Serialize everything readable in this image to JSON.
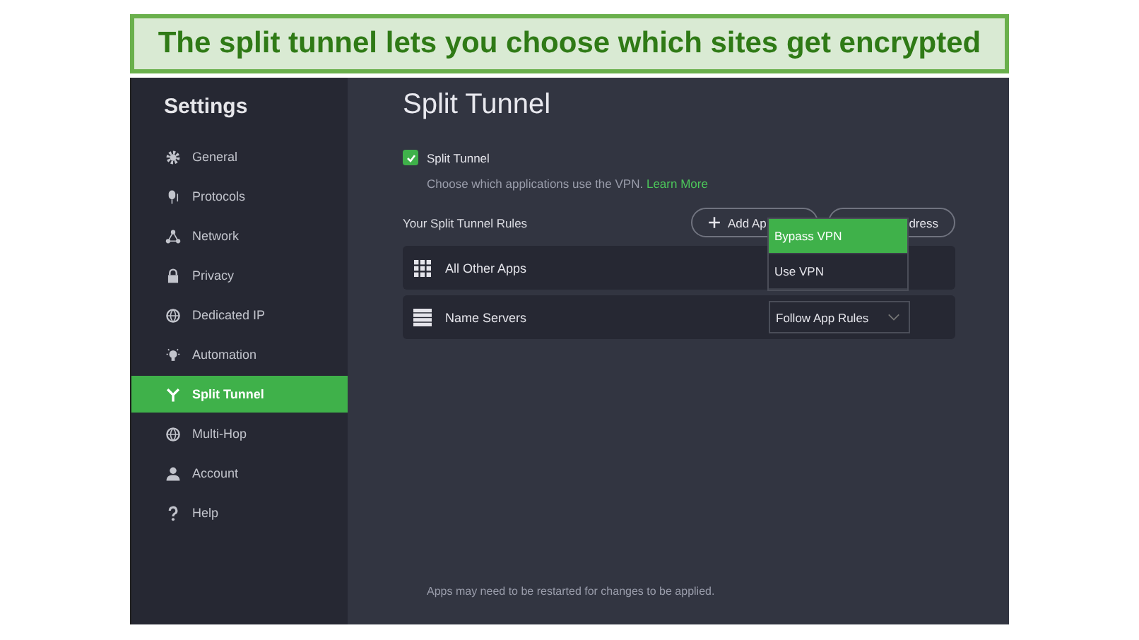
{
  "banner": {
    "text": "The split tunnel lets you choose which sites get encrypted"
  },
  "sidebar": {
    "title": "Settings",
    "items": [
      {
        "label": "General",
        "kind": "gear",
        "selected": false
      },
      {
        "label": "Protocols",
        "kind": "protocol",
        "selected": false
      },
      {
        "label": "Network",
        "kind": "network",
        "selected": false
      },
      {
        "label": "Privacy",
        "kind": "lock",
        "selected": false
      },
      {
        "label": "Dedicated IP",
        "kind": "globe",
        "selected": false
      },
      {
        "label": "Automation",
        "kind": "bulb",
        "selected": false
      },
      {
        "label": "Split Tunnel",
        "kind": "fork",
        "selected": true
      },
      {
        "label": "Multi-Hop",
        "kind": "globe",
        "selected": false
      },
      {
        "label": "Account",
        "kind": "person",
        "selected": false
      },
      {
        "label": "Help",
        "kind": "question",
        "selected": false
      }
    ]
  },
  "page": {
    "title": "Split Tunnel",
    "toggle": {
      "label": "Split Tunnel",
      "checked": true
    },
    "description": "Choose which applications use the VPN.",
    "link": "Learn More",
    "rules_label": "Your Split Tunnel Rules",
    "buttons": [
      {
        "label": "Add Ap",
        "kind": "plus"
      },
      {
        "label": "dress",
        "kind": "plain"
      }
    ],
    "rules": [
      {
        "name": "All Other Apps",
        "kind": "grid"
      },
      {
        "name": "Name Servers",
        "kind": "servers",
        "value": "Follow App Rules"
      }
    ],
    "dropdown": [
      {
        "label": "Bypass VPN",
        "selected": true
      },
      {
        "label": "Use VPN",
        "selected": false
      }
    ],
    "footer": "Apps may need to be restarted for changes to be applied."
  }
}
